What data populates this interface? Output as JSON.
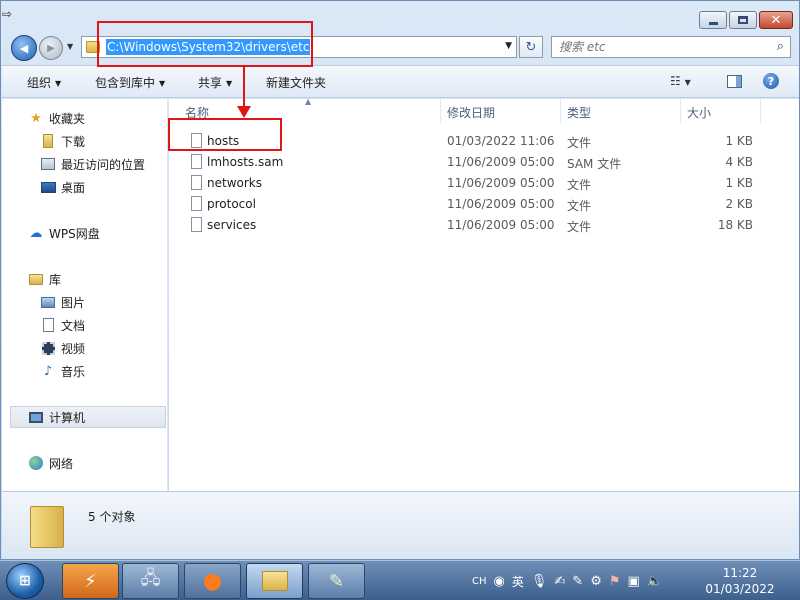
{
  "window": {
    "title_glyph": "⇨",
    "min_label": "",
    "max_label": "",
    "close_label": "✕"
  },
  "nav": {
    "back_glyph": "◀",
    "forward_glyph": "▶",
    "address_path": "C:\\Windows\\System32\\drivers\\etc",
    "refresh_glyph": "↻",
    "search_placeholder": "搜索 etc"
  },
  "toolbar": {
    "organize": "组织",
    "include_in_library": "包含到库中",
    "share": "共享",
    "new_folder": "新建文件夹",
    "help": "?"
  },
  "sidebar": {
    "favorites": "收藏夹",
    "downloads": "下载",
    "recent_places": "最近访问的位置",
    "desktop": "桌面",
    "wps_cloud": "WPS网盘",
    "libraries": "库",
    "pictures": "图片",
    "documents": "文档",
    "videos": "视频",
    "music": "音乐",
    "computer": "计算机",
    "network": "网络"
  },
  "columns": {
    "name": "名称",
    "date_modified": "修改日期",
    "type": "类型",
    "size": "大小"
  },
  "files": [
    {
      "name": "hosts",
      "date": "01/03/2022 11:06",
      "type": "文件",
      "size": "1 KB"
    },
    {
      "name": "lmhosts.sam",
      "date": "11/06/2009 05:00",
      "type": "SAM 文件",
      "size": "4 KB"
    },
    {
      "name": "networks",
      "date": "11/06/2009 05:00",
      "type": "文件",
      "size": "1 KB"
    },
    {
      "name": "protocol",
      "date": "11/06/2009 05:00",
      "type": "文件",
      "size": "2 KB"
    },
    {
      "name": "services",
      "date": "11/06/2009 05:00",
      "type": "文件",
      "size": "18 KB"
    }
  ],
  "details": {
    "object_count": "5 个对象"
  },
  "taskbar": {
    "ime_lang": "CH",
    "ime_mode": "英",
    "clock_time": "11:22",
    "clock_date": "01/03/2022"
  },
  "colors": {
    "annotation": "#e01515",
    "selection": "#3399ff"
  }
}
